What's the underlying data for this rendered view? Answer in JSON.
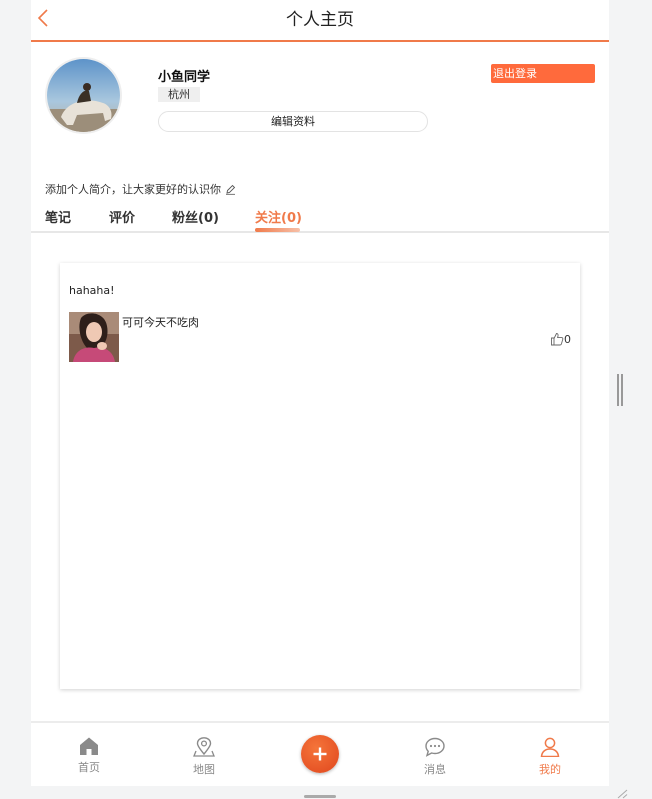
{
  "header": {
    "title": "个人主页"
  },
  "profile": {
    "username": "小鱼同学",
    "city": "杭州",
    "edit_label": "编辑资料",
    "logout_label": "退出登录",
    "bio_placeholder": "添加个人简介，让大家更好的认识你"
  },
  "tabs": [
    {
      "label": "笔记"
    },
    {
      "label": "评价"
    },
    {
      "label": "粉丝(0)"
    },
    {
      "label": "关注(0)"
    }
  ],
  "active_tab": "关注(0)",
  "post": {
    "text": "hahaha!",
    "caption": "可可今天不吃肉",
    "likes": "0"
  },
  "bottom_nav": [
    {
      "label": "首页",
      "icon": "home-icon"
    },
    {
      "label": "地图",
      "icon": "map-pin-icon"
    },
    {
      "label": "消息",
      "icon": "chat-icon"
    },
    {
      "label": "我的",
      "icon": "user-icon"
    }
  ],
  "colors": {
    "accent": "#f07a4a",
    "logout": "#ff6a3c",
    "plus": "#e94e24"
  }
}
